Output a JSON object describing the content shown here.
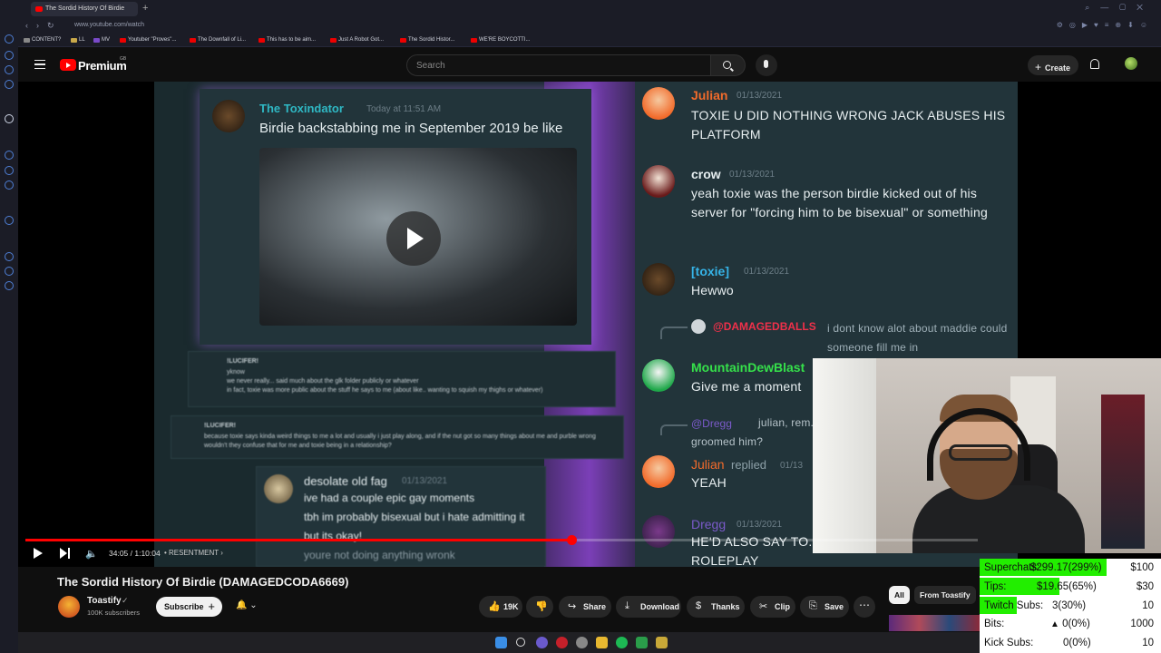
{
  "browser": {
    "tab_title": "The Sordid History Of Birdie",
    "url": "www.youtube.com/watch",
    "bookmarks": [
      "CONTENT?",
      "LL",
      "MV",
      "Youtuber \"Proves\"...",
      "The Downfall of Li...",
      "This has to be aim...",
      "Just A Robot Got...",
      "The Sordid Histor...",
      "WE'RE BOYCOTTI..."
    ]
  },
  "youtube": {
    "logo_text": "Premium",
    "region": "GB",
    "search_placeholder": "Search",
    "create_label": "Create"
  },
  "video_frame": {
    "left_message": {
      "author": "The Toxindator",
      "timestamp": "Today at 11:51 AM",
      "text": "Birdie backstabbing me in September 2019 be like"
    },
    "lucifer_1": {
      "author": "!LUCIFER!",
      "text": "yknow\nwe never really... said much about the glk folder publicly or whatever\nin fact, toxie was more public about the stuff he says to me (about like.. wanting to squish my thighs or whatever)"
    },
    "lucifer_2": {
      "author": "!LUCIFER!",
      "text": "because toxie says kinda weird things to me a lot and usually i just play along, and if the nut got so many things about me and purble wrong wouldn't they confuse that for me and toxie being in a relationship?"
    },
    "desolate": {
      "author": "desolate old fag",
      "timestamp": "01/13/2021",
      "lines": [
        "ive had a couple epic gay moments",
        "tbh im probably bisexual but i hate admitting it",
        "but its okay!",
        "youre not doing anything wronk"
      ]
    },
    "chat": [
      {
        "author": "Julian",
        "timestamp": "01/13/2021",
        "text": "TOXIE U DID NOTHING WRONG JACK ABUSES HIS PLATFORM"
      },
      {
        "author": "crow",
        "timestamp": "01/13/2021",
        "text": "yeah toxie was the person birdie kicked out of his server for \"forcing him to be bisexual\" or something"
      },
      {
        "author": "[toxie]",
        "timestamp": "01/13/2021",
        "text": "Hewwo"
      },
      {
        "author": "@DAMAGEDBALLS",
        "timestamp": "",
        "text": "i dont know alot about maddie could someone fill me in"
      },
      {
        "author": "MountainDewBlast",
        "timestamp": "",
        "text": "Give me a moment"
      },
      {
        "author": "@Dregg",
        "timestamp": "",
        "text": "julian, rem... groomed him?"
      },
      {
        "author": "Julian",
        "timestamp": "01/13",
        "text": "YEAH",
        "suffix": "replied"
      },
      {
        "author": "Dregg",
        "timestamp": "01/13/2021",
        "text": "HE'D ALSO SAY TO... ROLEPLAY"
      }
    ]
  },
  "player": {
    "time": "34:05 / 1:10:04",
    "chapter": "• RESENTMENT",
    "progress": 0.573
  },
  "video_info": {
    "title": "The Sordid History Of Birdie (DAMAGEDCODA6669)",
    "channel": "Toastify",
    "subscribers": "100K subscribers",
    "subscribe_label": "Subscribe",
    "likes": "19K",
    "share_label": "Share",
    "download_label": "Download",
    "thanks_label": "Thanks",
    "clip_label": "Clip",
    "save_label": "Save"
  },
  "filter_chips": [
    "All",
    "From Toastify"
  ],
  "goals": [
    {
      "label": "Superchats:",
      "current": "$299.17(299%)",
      "target": "$100",
      "fraction": 1.0
    },
    {
      "label": "Tips:",
      "current": "$19.65(65%)",
      "target": "$30",
      "fraction": 0.65
    },
    {
      "label": "Twitch Subs:",
      "current": "3(30%)",
      "target": "10",
      "fraction": 0.3
    },
    {
      "label": "Bits:",
      "current": "0(0%)",
      "target": "1000",
      "fraction": 0
    },
    {
      "label": "Kick Subs:",
      "current": "0(0%)",
      "target": "10",
      "fraction": 0
    }
  ],
  "colors": {
    "accent": "#ff0000",
    "goal_bar": "#22ee00",
    "toxindator": "#2fb8c4",
    "julian": "#f26b2b",
    "toxie": "#36b4e8",
    "damaged": "#f0304a",
    "mountain": "#35e04a"
  }
}
